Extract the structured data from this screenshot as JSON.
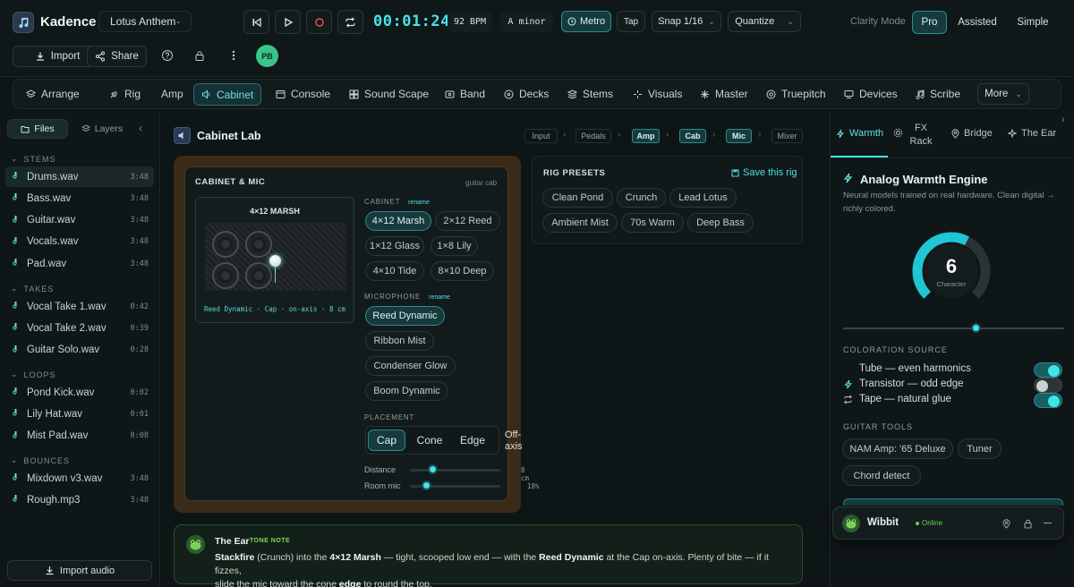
{
  "app": {
    "name": "Kadence",
    "logo_icon": "music-note-icon"
  },
  "project": {
    "name": "Lotus Anthem"
  },
  "transport": {
    "time": "00:01:24",
    "bpm": "92 BPM",
    "key": "A minor",
    "metro": "Metro",
    "tap": "Tap",
    "snap": "Snap 1/16",
    "quantize": "Quantize"
  },
  "clarity": {
    "label": "Clarity Mode",
    "modes": [
      "Pro",
      "Assisted",
      "Simple"
    ],
    "active": "Pro"
  },
  "toolbar": {
    "import": "Import",
    "share": "Share",
    "avatar": "PB"
  },
  "nav": {
    "items": [
      "Arrange",
      "Rig",
      "Amp",
      "Cabinet",
      "Console",
      "Sound Scape",
      "Band",
      "Decks",
      "Stems",
      "Visuals",
      "Master",
      "Truepitch",
      "Devices",
      "Scribe"
    ],
    "active": "Cabinet",
    "more": "More"
  },
  "sidebar": {
    "tabs": [
      "Files",
      "Layers"
    ],
    "sections": {
      "stems": "STEMS",
      "takes": "TAKES",
      "loops": "LOOPS",
      "bounces": "BOUNCES"
    },
    "stems": [
      {
        "name": "Drums.wav",
        "dur": "3:48"
      },
      {
        "name": "Bass.wav",
        "dur": "3:48"
      },
      {
        "name": "Guitar.wav",
        "dur": "3:48"
      },
      {
        "name": "Vocals.wav",
        "dur": "3:48"
      },
      {
        "name": "Pad.wav",
        "dur": "3:48"
      }
    ],
    "takes": [
      {
        "name": "Vocal Take 1.wav",
        "dur": "0:42"
      },
      {
        "name": "Vocal Take 2.wav",
        "dur": "0:39"
      },
      {
        "name": "Guitar Solo.wav",
        "dur": "0:28"
      }
    ],
    "loops": [
      {
        "name": "Pond Kick.wav",
        "dur": "0:02"
      },
      {
        "name": "Lily Hat.wav",
        "dur": "0:01"
      },
      {
        "name": "Mist Pad.wav",
        "dur": "0:08"
      }
    ],
    "bounces": [
      {
        "name": "Mixdown v3.wav",
        "dur": "3:48"
      },
      {
        "name": "Rough.mp3",
        "dur": "3:48"
      }
    ],
    "import_audio": "Import audio"
  },
  "main": {
    "title": "Cabinet Lab",
    "breadcrumb": [
      "Input",
      "Pedals",
      "Amp",
      "Cab",
      "Mic",
      "Mixer"
    ],
    "breadcrumb_active": [
      "Amp",
      "Cab",
      "Mic"
    ],
    "cab_panel": {
      "title": "CABINET & MIC",
      "tag": "guitar cab",
      "cab_name": "4×12 MARSH",
      "status": "Reed Dynamic · Cap · on-axis · 8 cm",
      "cabinet_label": "CABINET",
      "rename": "rename",
      "cabinets": [
        "4×12 Marsh",
        "2×12 Reed",
        "1×12 Glass",
        "1×8 Lily",
        "4×10 Tide",
        "8×10 Deep"
      ],
      "cabinet_selected": "4×12 Marsh",
      "mic_label": "MICROPHONE",
      "mics": [
        "Reed Dynamic",
        "Ribbon Mist",
        "Condenser Glow",
        "Boom Dynamic"
      ],
      "mic_selected": "Reed Dynamic",
      "placement_label": "PLACEMENT",
      "placements": [
        "Cap",
        "Cone",
        "Edge",
        "Off-axis"
      ],
      "placement_selected": "Cap",
      "distance_label": "Distance",
      "distance_value": "8 cm",
      "distance_fraction": 0.25,
      "roommic_label": "Room mic",
      "roommic_value": "18%",
      "roommic_fraction": 0.18
    },
    "rig_presets": {
      "title": "RIG PRESETS",
      "save": "Save this rig",
      "items": [
        "Clean Pond",
        "Crunch",
        "Lead Lotus",
        "Ambient Mist",
        "70s Warm",
        "Deep Bass"
      ]
    },
    "ear_note": {
      "title": "The Ear",
      "badge": "TONE NOTE",
      "t1": "Stackfire",
      "t2": " (Crunch) into the ",
      "t3": "4×12 Marsh",
      "t4": " — tight, scooped low end — with the ",
      "t5": "Reed Dynamic",
      "t6": " at the Cap on-axis. Plenty of bite — if it fizzes,",
      "t7": "slide the mic toward the cone ",
      "t8": "edge",
      "t9": " to round the top."
    }
  },
  "right": {
    "tabs": [
      "Warmth",
      "FX Rack",
      "Bridge",
      "The Ear"
    ],
    "active_tab": "Warmth",
    "engine_title": "Analog Warmth Engine",
    "engine_desc_1": "Neural models trained on real hardware. Clean digital →",
    "engine_desc_2": "richly colored.",
    "character_value": "6",
    "character_label": "Character",
    "character_fraction": 0.6,
    "slider_fraction": 0.6,
    "coloration_label": "COLORATION SOURCE",
    "coloration": [
      {
        "name": "Tube — even harmonics",
        "on": true
      },
      {
        "name": "Transistor — odd edge",
        "on": false
      },
      {
        "name": "Tape — natural glue",
        "on": true
      }
    ],
    "guitar_tools_label": "GUITAR TOOLS",
    "guitar_tools": [
      "NAM Amp: '65 Deluxe",
      "Tuner",
      "Chord detect"
    ]
  },
  "wibbit": {
    "name": "Wibbit",
    "status": "Online"
  },
  "colors": {
    "accent": "#3fe4ea",
    "bg": "#0e1516",
    "panel_border": "#3a2a18"
  }
}
